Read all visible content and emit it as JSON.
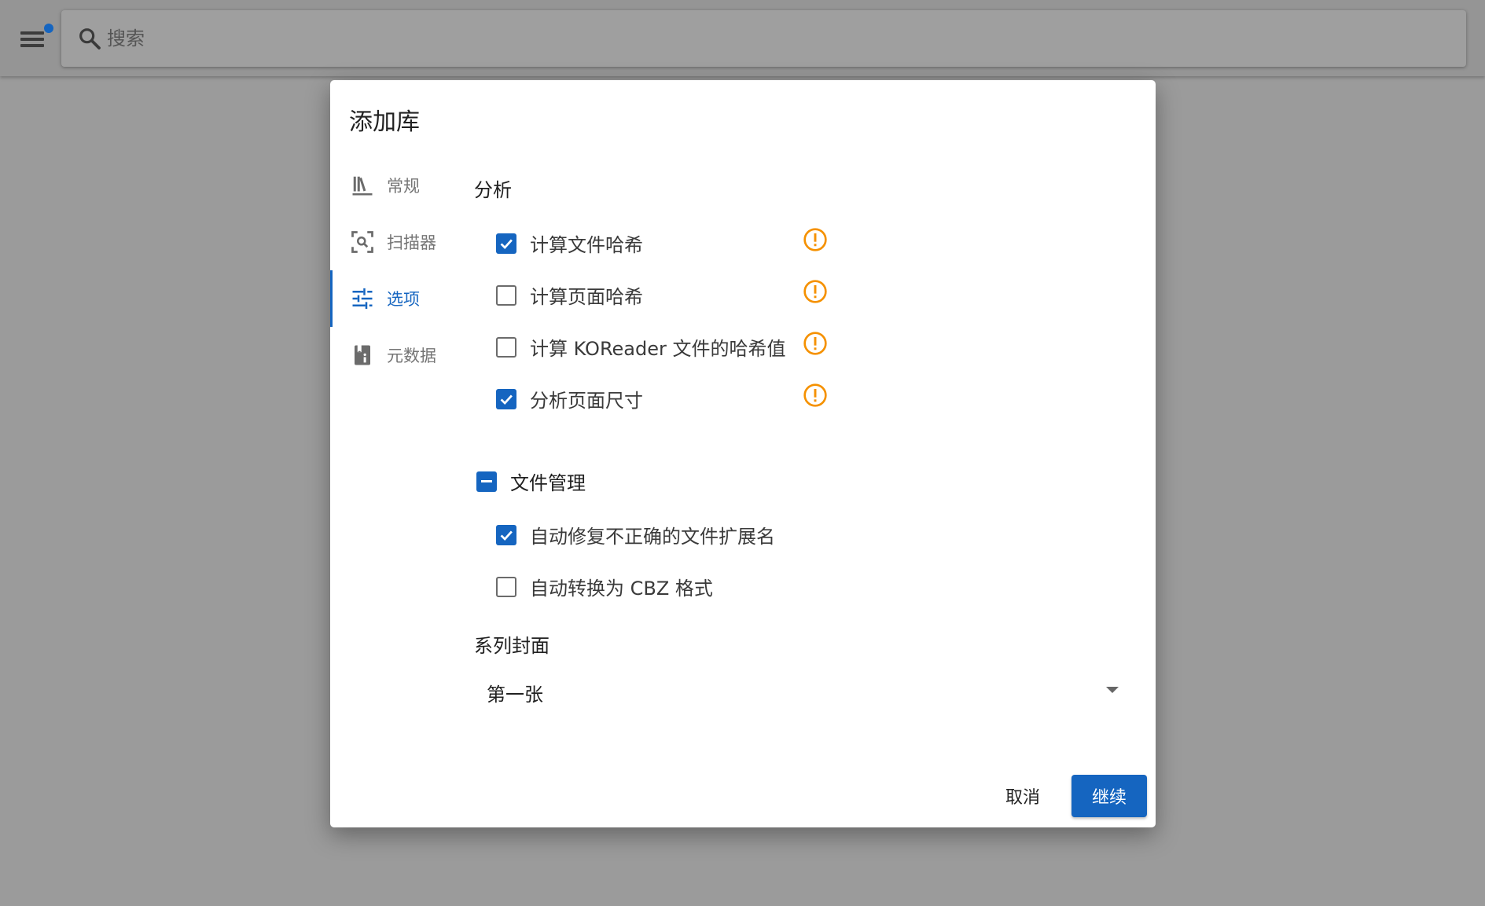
{
  "search": {
    "placeholder": "搜索"
  },
  "dialog": {
    "title": "添加库",
    "tabs": [
      {
        "label": "常规",
        "icon": "library-books-icon"
      },
      {
        "label": "扫描器",
        "icon": "scan-search-icon"
      },
      {
        "label": "选项",
        "icon": "tune-sliders-icon",
        "active": true
      },
      {
        "label": "元数据",
        "icon": "book-info-icon"
      }
    ],
    "analysis": {
      "title": "分析",
      "items": [
        {
          "label": "计算文件哈希",
          "checked": true
        },
        {
          "label": "计算页面哈希",
          "checked": false
        },
        {
          "label": "计算 KOReader 文件的哈希值",
          "checked": false
        },
        {
          "label": "分析页面尺寸",
          "checked": true
        }
      ]
    },
    "file_management": {
      "title": "文件管理",
      "state": "indeterminate",
      "items": [
        {
          "label": "自动修复不正确的文件扩展名",
          "checked": true
        },
        {
          "label": "自动转换为 CBZ 格式",
          "checked": false
        }
      ]
    },
    "series_cover": {
      "title": "系列封面",
      "value": "第一张"
    },
    "actions": {
      "cancel": "取消",
      "continue": "继续"
    }
  },
  "colors": {
    "accent": "#1565c0",
    "warning": "#f59100"
  }
}
